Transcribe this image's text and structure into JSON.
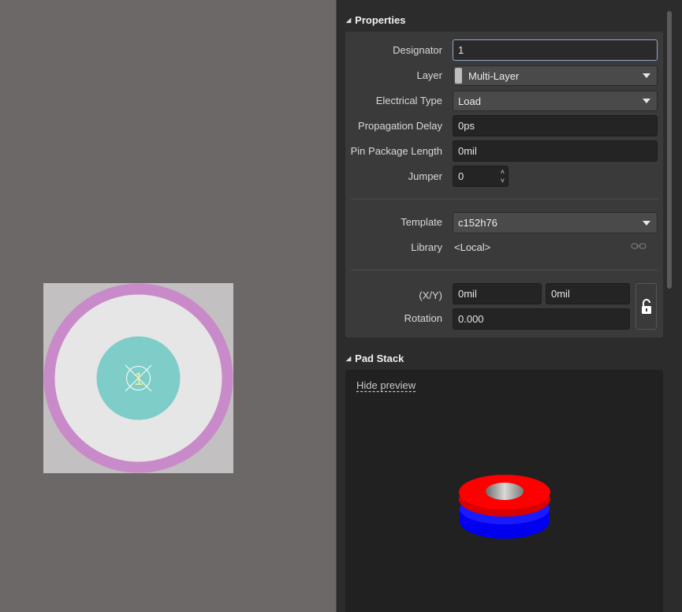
{
  "canvas": {
    "pad_designator": "1"
  },
  "properties": {
    "section_title": "Properties",
    "designator_label": "Designator",
    "designator_value": "1",
    "layer_label": "Layer",
    "layer_value": "Multi-Layer",
    "electrical_type_label": "Electrical Type",
    "electrical_type_value": "Load",
    "propagation_delay_label": "Propagation Delay",
    "propagation_delay_value": "0ps",
    "pin_package_length_label": "Pin Package Length",
    "pin_package_length_value": "0mil",
    "jumper_label": "Jumper",
    "jumper_value": "0",
    "template_label": "Template",
    "template_value": "c152h76",
    "library_label": "Library",
    "library_value": "<Local>",
    "xy_label": "(X/Y)",
    "x_value": "0mil",
    "y_value": "0mil",
    "rotation_label": "Rotation",
    "rotation_value": "0.000"
  },
  "pad_stack": {
    "section_title": "Pad Stack",
    "hide_preview_label": "Hide preview"
  },
  "icons": [
    "collapse-triangle-icon",
    "dropdown-caret-icon",
    "spin-up-icon",
    "spin-down-icon",
    "link-icon",
    "unlock-icon"
  ],
  "colors": {
    "canvas_bg": "#6b6867",
    "pad_outer_ring": "#c98ac9",
    "pad_copper": "#e6e6e6",
    "pad_hole": "#7ecdc8",
    "stack_top": "#ff0000",
    "stack_bottom": "#0000ff"
  }
}
